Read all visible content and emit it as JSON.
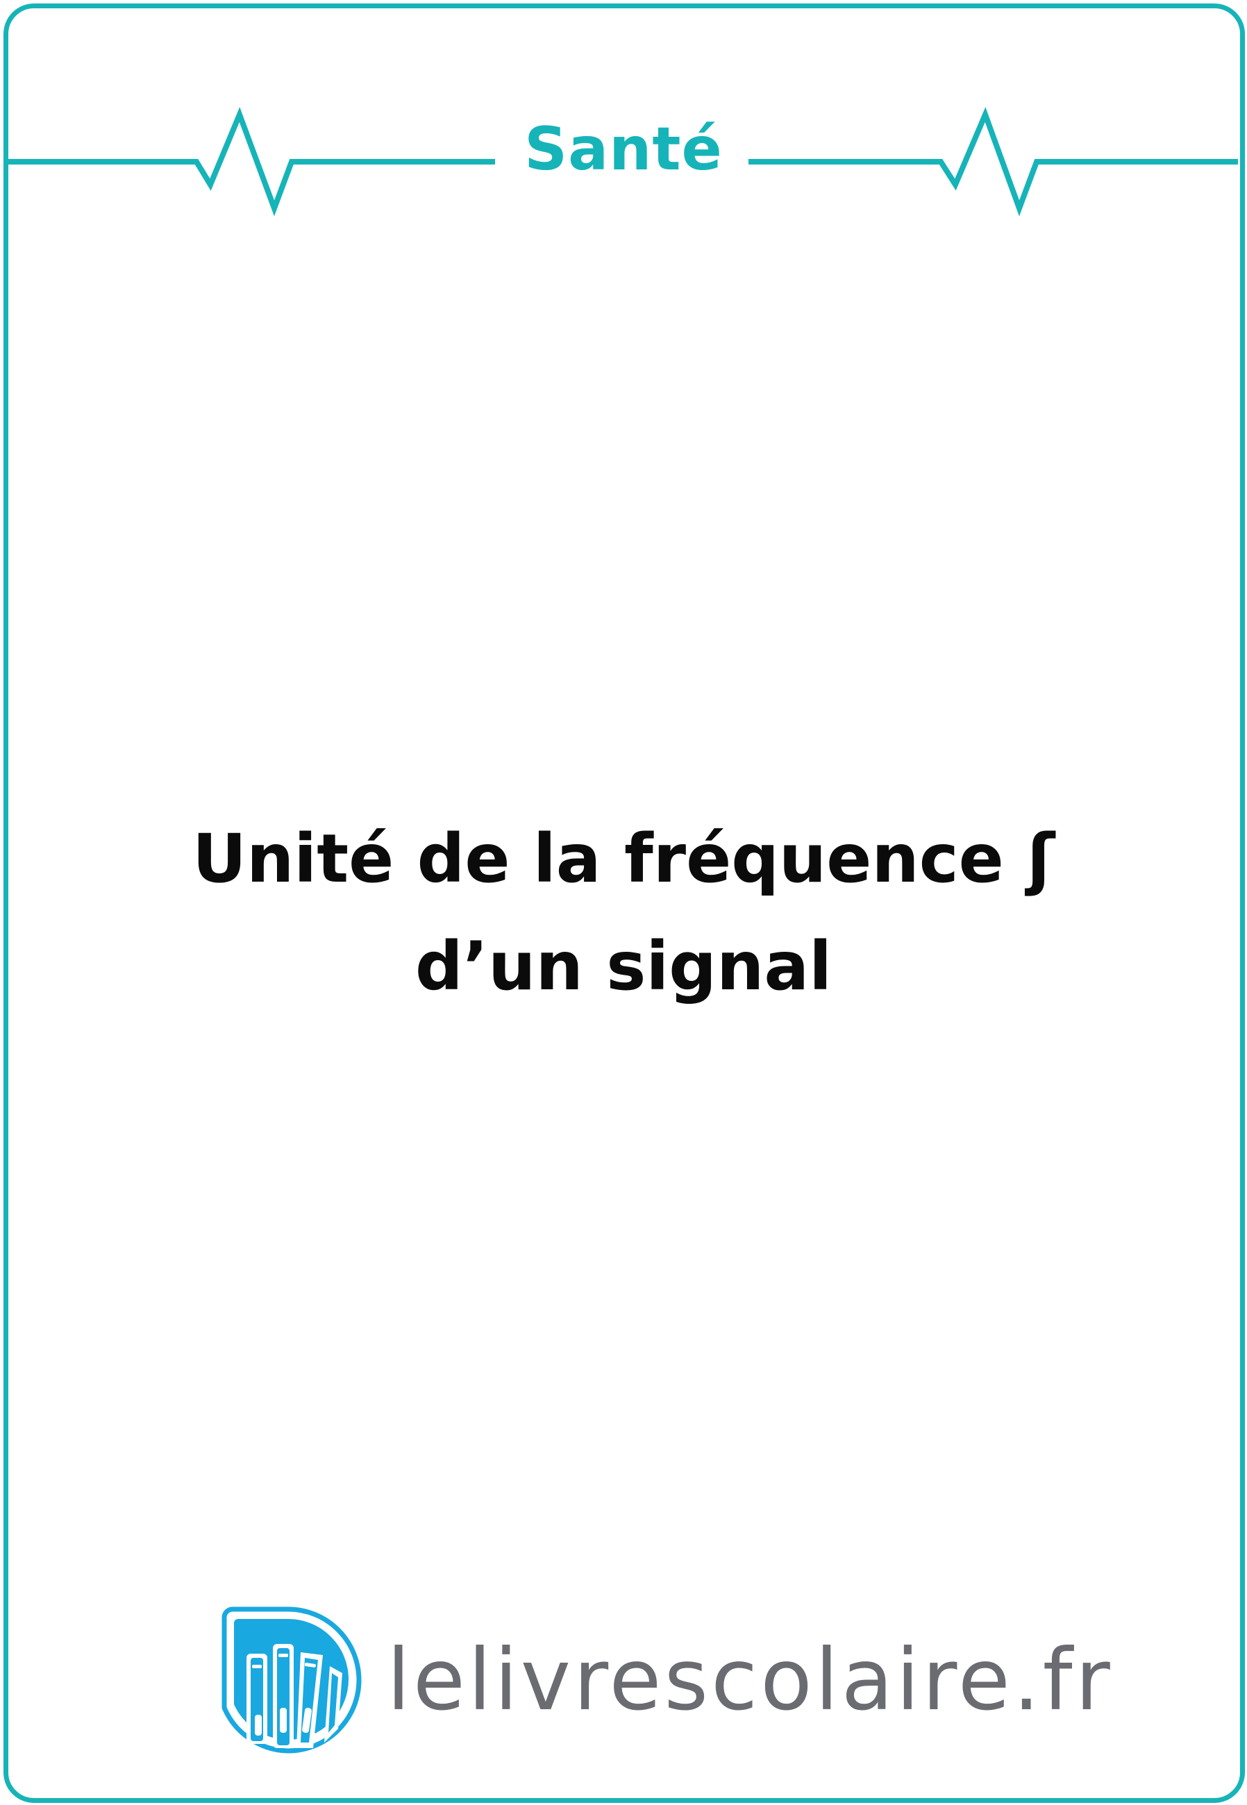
{
  "card": {
    "category": "Santé",
    "question_line1": "Unité de la fréquence ʃ",
    "question_line2": "d’un signal"
  },
  "footer": {
    "brand": "lelivrescolaire.fr",
    "logo_icon": "books-logo-icon"
  },
  "colors": {
    "accent": "#16b4b8",
    "text": "#0b0b0b",
    "brand_text": "#6b6b72",
    "logo_blue": "#1aa8e0"
  }
}
